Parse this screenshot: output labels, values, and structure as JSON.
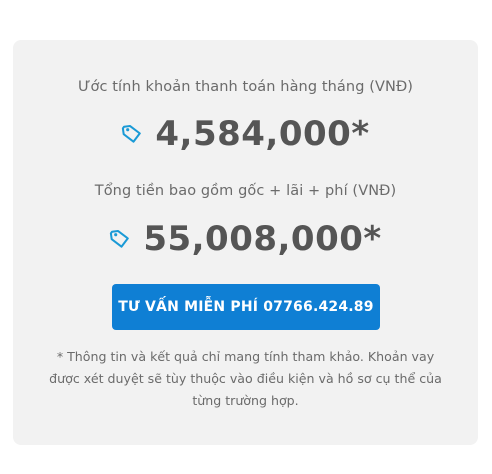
{
  "monthly": {
    "label": "Ước tính khoản thanh toán hàng tháng (VNĐ)",
    "amount": "4,584,000*"
  },
  "total": {
    "label": "Tổng tiền bao gồm gốc + lãi + phí (VNĐ)",
    "amount": "55,008,000*"
  },
  "cta": {
    "label": "TƯ VẤN MIỄN PHÍ 07766.424.89"
  },
  "note": {
    "text": "* Thông tin và kết quả chỉ mang tính tham khảo. Khoản vay được xét duyệt sẽ tùy thuộc vào điều kiện và hồ sơ cụ thể của từng trường hợp."
  },
  "colors": {
    "accent": "#0f7fd4",
    "icon": "#1a9ad6",
    "amount_text": "#555555",
    "label_text": "#6b6b6b",
    "card_bg": "#f2f2f2"
  },
  "icons": {
    "price_tag": "price-tag-icon"
  }
}
